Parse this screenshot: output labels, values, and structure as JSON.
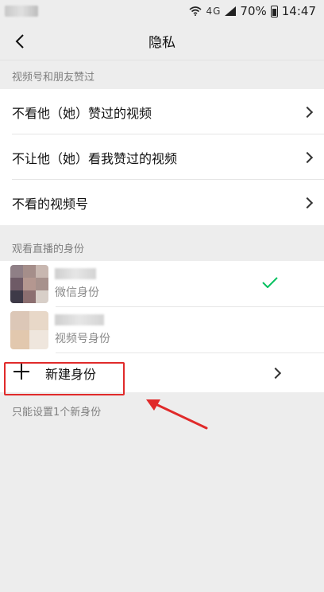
{
  "status_bar": {
    "network": "4G",
    "battery_percent": "70%",
    "time": "14:47"
  },
  "header": {
    "title": "隐私"
  },
  "sections": {
    "likes_header": "视频号和朋友赞过",
    "likes_items": [
      {
        "label": "不看他（她）赞过的视频"
      },
      {
        "label": "不让他（她）看我赞过的视频"
      },
      {
        "label": "不看的视频号"
      }
    ],
    "live_header": "观看直播的身份",
    "identities": [
      {
        "type_label": "微信身份",
        "selected": true
      },
      {
        "type_label": "视频号身份",
        "selected": false
      }
    ],
    "new_identity_label": "新建身份",
    "footnote": "只能设置1个新身份"
  },
  "colors": {
    "check": "#07c160",
    "annotation_red": "#e02a2a"
  },
  "icons": {
    "back": "chevron-left-icon",
    "chevron": "chevron-right-icon",
    "check": "check-icon",
    "plus": "plus-icon"
  }
}
